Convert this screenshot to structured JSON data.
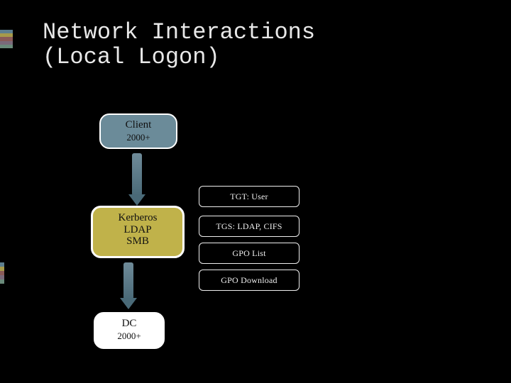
{
  "title": "Network Interactions\n(Local Logon)",
  "nodes": {
    "client": {
      "line1": "Client",
      "line2": "2000+"
    },
    "middle": {
      "line1": "Kerberos",
      "line2": "LDAP",
      "line3": "SMB"
    },
    "dc": {
      "line1": "DC",
      "line2": "2000+"
    }
  },
  "tags": [
    "TGT: User",
    "TGS: LDAP, CIFS",
    "GPO List",
    "GPO Download"
  ]
}
